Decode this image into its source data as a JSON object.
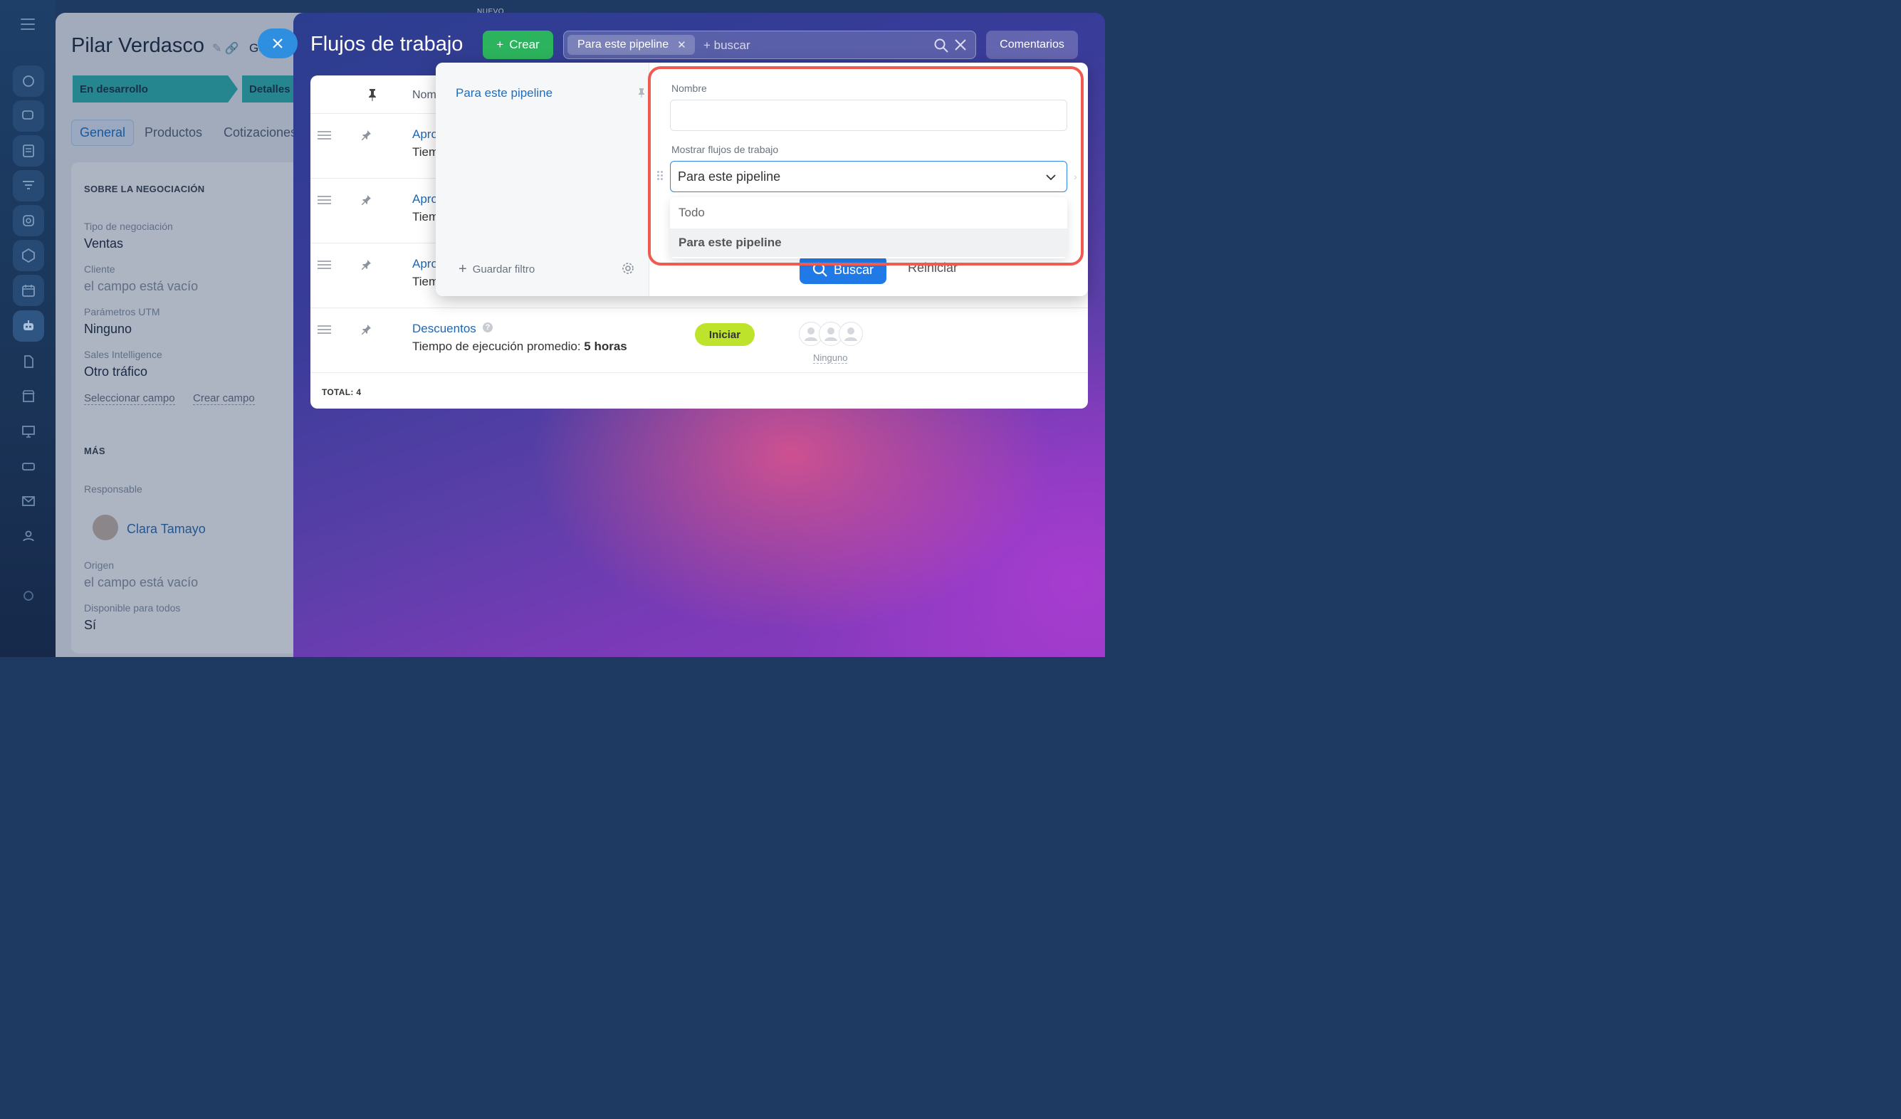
{
  "top_label": "NUEVO",
  "rail": {
    "icons": [
      "menu-icon",
      "activity-icon",
      "chat-icon",
      "tasks-icon",
      "funnel-icon",
      "crm-icon",
      "sites-icon",
      "calendar-icon",
      "robot-icon",
      "docs-icon",
      "store-icon",
      "presentation-icon",
      "tickets-icon",
      "mail-icon",
      "contacts-icon",
      "settings-icon"
    ]
  },
  "deal": {
    "title": "Pilar Verdasco",
    "title_tail": "Ge",
    "stages": [
      "En desarrollo",
      "Detalles"
    ],
    "tabs": [
      "General",
      "Productos",
      "Cotizaciones"
    ],
    "section_about": "SOBRE LA NEGOCIACIÓN",
    "fields": [
      {
        "label": "Tipo de negociación",
        "value": "Ventas"
      },
      {
        "label": "Cliente",
        "value": "el campo está vacío"
      },
      {
        "label": "Parámetros UTM",
        "value": "Ninguno"
      },
      {
        "label": "Sales Intelligence",
        "value": "Otro tráfico"
      }
    ],
    "links": [
      "Seleccionar campo",
      "Crear campo"
    ],
    "section_more": "MÁS",
    "responsible_label": "Responsable",
    "responsible_name": "Clara Tamayo",
    "origin_label": "Origen",
    "origin_value": "el campo está vacío",
    "extra_label": "Disponible para todos",
    "extra_value": "Sí"
  },
  "slider": {
    "title": "Flujos de trabajo",
    "create_label": "Crear",
    "search": {
      "chip_label": "Para este pipeline",
      "placeholder": "+ buscar"
    },
    "comments_label": "Comentarios",
    "table": {
      "name_header": "Nom",
      "rows": [
        {
          "name": "Apro",
          "sub": "Tiem"
        },
        {
          "name": "Apro",
          "sub": "Tiem"
        },
        {
          "name": "Apro",
          "sub": "Tiem"
        },
        {
          "name": "Descuentos",
          "sub_prefix": "Tiempo de ejecución promedio: ",
          "sub_bold": "5 horas",
          "action": "Iniciar",
          "assignees": "Ninguno"
        }
      ],
      "total_label": "TOTAL: ",
      "total_value": "4"
    }
  },
  "filter": {
    "preset": "Para este pipeline",
    "save_filter": "Guardar filtro",
    "name_label": "Nombre",
    "name_value": "",
    "show_label": "Mostrar flujos de trabajo",
    "show_selected": "Para este pipeline",
    "options": [
      "Todo",
      "Para este pipeline"
    ],
    "search_button": "Buscar",
    "reset_button": "Reiniciar"
  },
  "colors": {
    "accent": "#1f7ae8",
    "create": "#2cb35d",
    "start": "#bde32b",
    "highlight": "#ef5b50",
    "stage": "#2fb8b3"
  }
}
